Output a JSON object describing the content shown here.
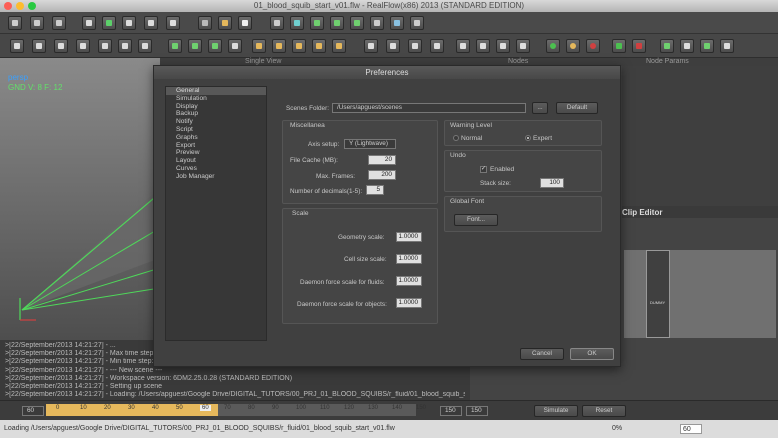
{
  "window": {
    "title": "01_blood_squib_start_v01.flw - RealFlow(x86) 2013 (STANDARD EDITION)"
  },
  "panels": {
    "viewport": "Single View",
    "nodes": "Nodes",
    "node_params": "Node Params",
    "clip_editor": "Clip Editor",
    "clip_tag": "DUMMY"
  },
  "viewport": {
    "perspective": "persp",
    "info": "GND V: 8 F: 12"
  },
  "log_lines": [
    ">[22/September/2013 14:21:27] - ...",
    ">[22/September/2013 14:21:27] - Max time step: 0.125",
    ">[22/September/2013 14:21:27] - Min time step: 0.0004",
    ">[22/September/2013 14:21:27] - --- New scene ---",
    ">[22/September/2013 14:21:27] - Workspace version: 6DM2.25.0.28 (STANDARD EDITION)",
    ">[22/September/2013 14:21:27] - Setting up scene",
    ">[22/September/2013 14:21:27] - Loading: /Users/apguest/Google Drive/DIGITAL_TUTORS/00_PRJ_01_BLOOD_SQUIBS/r_fluid/01_blood_squib_start_v01.flw"
  ],
  "timeline": {
    "start": "60",
    "ticks": [
      "0",
      "10",
      "20",
      "30",
      "40",
      "50",
      "60",
      "70",
      "80",
      "90",
      "100",
      "110",
      "120",
      "130",
      "140",
      "150"
    ],
    "current": "60",
    "end1": "150",
    "end2": "150",
    "simulate": "Simulate",
    "reset": "Reset",
    "zoom": "0%",
    "frame": "60"
  },
  "status": "Loading /Users/apguest/Google Drive/DIGITAL_TUTORS/00_PRJ_01_BLOOD_SQUIBS/r_fluid/01_blood_squib_start_v01.flw",
  "dialog": {
    "title": "Preferences",
    "categories": [
      "General",
      "Simulation",
      "Display",
      "Backup",
      "Notify",
      "Script",
      "Graphs",
      "Export",
      "Preview",
      "Layout",
      "Curves",
      "Job Manager"
    ],
    "scenes_folder_label": "Scenes Folder:",
    "scenes_folder_value": "/Users/apguest/scenes",
    "browse_label": "...",
    "default_label": "Default",
    "misc": {
      "title": "Miscellanea",
      "axis_label": "Axis setup:",
      "axis_value": "Y (Lightwave)",
      "cache_label": "File Cache (MB):",
      "cache_value": "20",
      "frames_label": "Max. Frames:",
      "frames_value": "200",
      "decimals_label": "Number of decimals(1-5):",
      "decimals_value": "5"
    },
    "warning": {
      "title": "Warning Level",
      "normal": "Normal",
      "expert": "Expert",
      "selected": "expert"
    },
    "undo": {
      "title": "Undo",
      "enabled_label": "Enabled",
      "enabled": true,
      "stack_label": "Stack size:",
      "stack_value": "100"
    },
    "font": {
      "title": "Global Font",
      "button": "Font..."
    },
    "scale": {
      "title": "Scale",
      "geometry_label": "Geometry scale:",
      "geometry_value": "1.0000",
      "cell_label": "Cell size scale:",
      "cell_value": "1.0000",
      "fluids_label": "Daemon force scale for fluids:",
      "fluids_value": "1.0000",
      "objects_label": "Daemon force scale for objects:",
      "objects_value": "1.0000"
    },
    "cancel": "Cancel",
    "ok": "OK"
  },
  "colors": {
    "accent_timeline": "#e5b85c",
    "viewport_text": "#62e06a"
  }
}
